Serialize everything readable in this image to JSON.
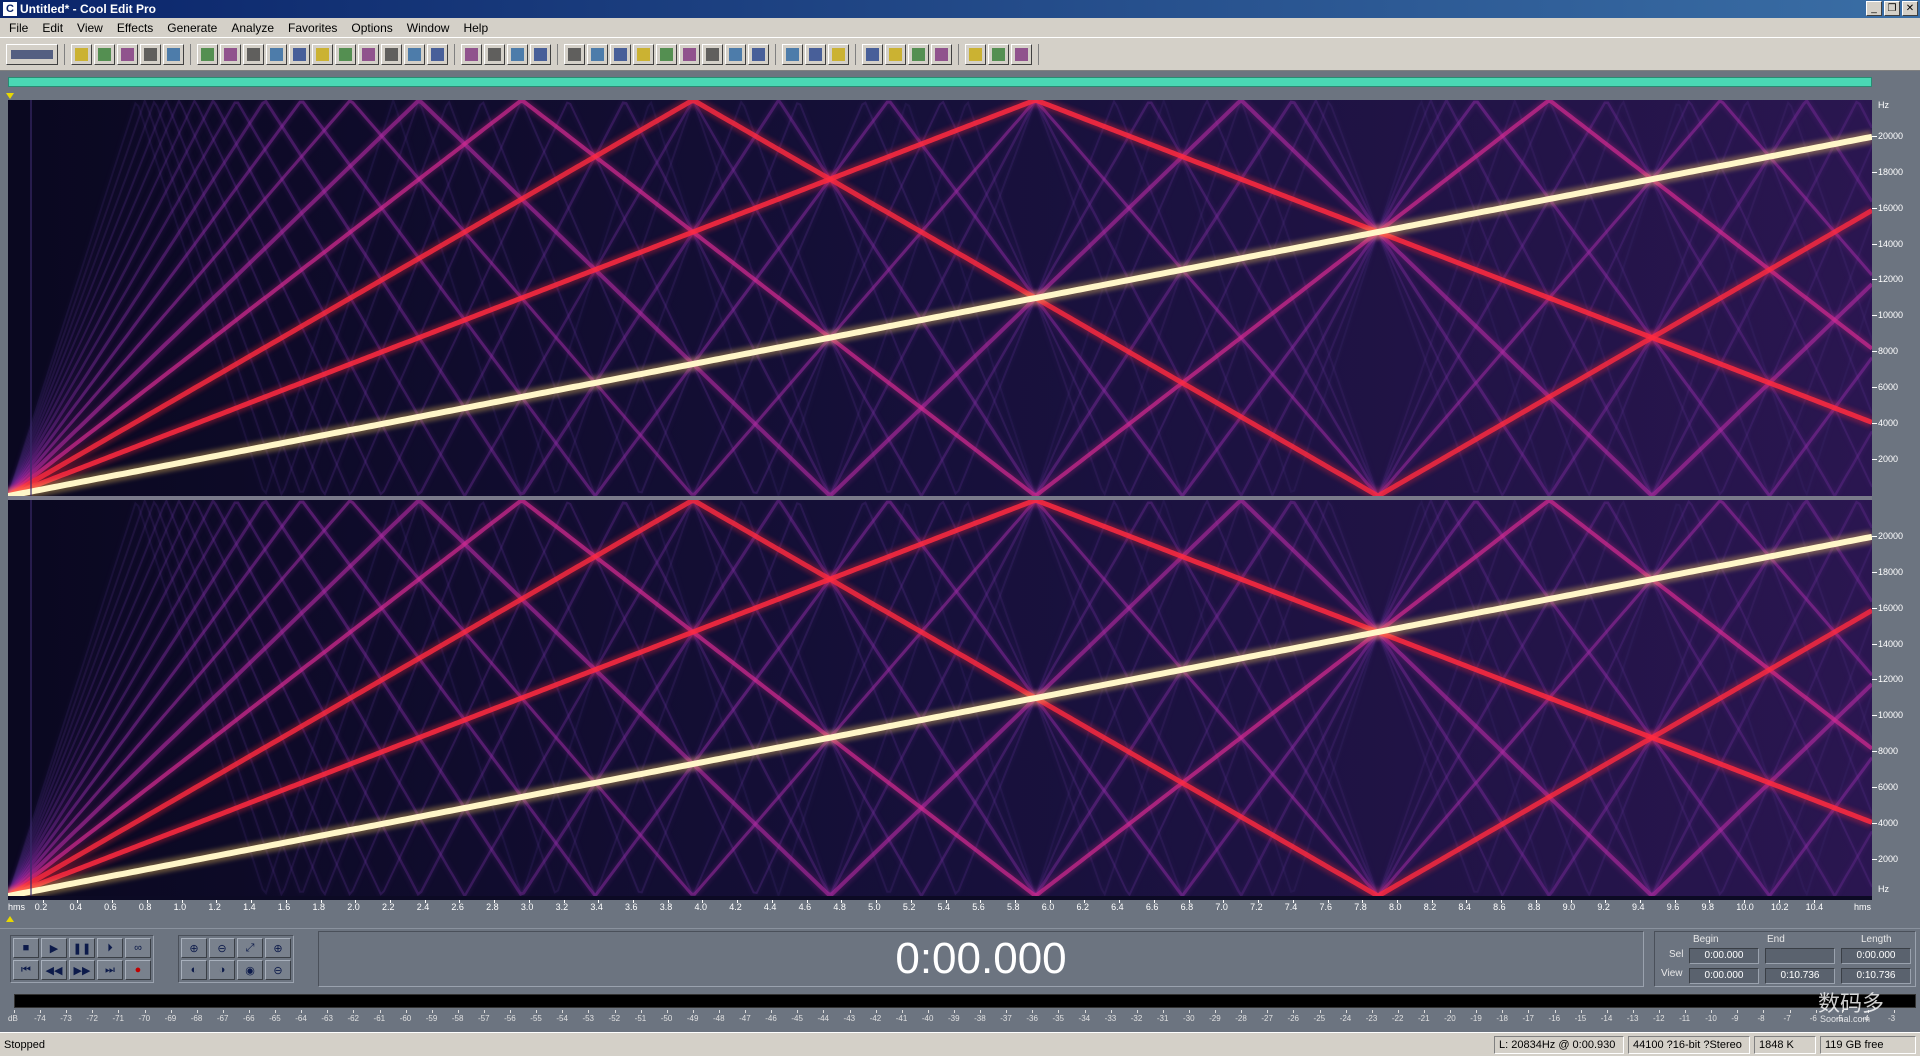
{
  "window": {
    "title": "Untitled* - Cool Edit Pro"
  },
  "menu": [
    "File",
    "Edit",
    "View",
    "Effects",
    "Generate",
    "Analyze",
    "Favorites",
    "Options",
    "Window",
    "Help"
  ],
  "toolbar_groups": [
    [
      "waveform-toggle"
    ],
    [
      "new-file",
      "open-file",
      "save",
      "save-as",
      "close"
    ],
    [
      "undo",
      "redo",
      "trim",
      "copy",
      "copy-new",
      "cut",
      "paste",
      "paste-new",
      "mix-paste",
      "repeat",
      "find"
    ],
    [
      "spectral-view",
      "edit-cue",
      "channel-mix",
      "mix-both"
    ],
    [
      "insert",
      "convert",
      "rate",
      "play",
      "zoom",
      "time-code",
      "bits",
      "meters",
      "settings"
    ],
    [
      "properties",
      "help-search",
      "help"
    ],
    [
      "brush-1",
      "brush-2",
      "brush-3",
      "brush-4"
    ],
    [
      "script-1",
      "script-2",
      "script-3"
    ]
  ],
  "frequency_axis": {
    "unit": "Hz",
    "ticks": [
      "20000",
      "18000",
      "16000",
      "14000",
      "12000",
      "10000",
      "8000",
      "6000",
      "4000",
      "2000"
    ]
  },
  "time_axis": {
    "start_label": "hms",
    "end_label": "hms",
    "ticks": [
      "0.2",
      "0.4",
      "0.6",
      "0.8",
      "1.0",
      "1.2",
      "1.4",
      "1.6",
      "1.8",
      "2.0",
      "2.2",
      "2.4",
      "2.6",
      "2.8",
      "3.0",
      "3.2",
      "3.4",
      "3.6",
      "3.8",
      "4.0",
      "4.2",
      "4.4",
      "4.6",
      "4.8",
      "5.0",
      "5.2",
      "5.4",
      "5.6",
      "5.8",
      "6.0",
      "6.2",
      "6.4",
      "6.6",
      "6.8",
      "7.0",
      "7.2",
      "7.4",
      "7.6",
      "7.8",
      "8.0",
      "8.2",
      "8.4",
      "8.6",
      "8.8",
      "9.0",
      "9.2",
      "9.4",
      "9.6",
      "9.8",
      "10.0",
      "10.2",
      "10.4"
    ],
    "max_seconds": 10.736
  },
  "transport": {
    "time": "0:00.000",
    "row1": [
      "stop",
      "play",
      "pause",
      "play-to-end",
      "loop"
    ],
    "row2": [
      "go-to-start",
      "rewind",
      "fast-forward",
      "go-to-end",
      "record"
    ],
    "zoom_row1": [
      "zoom-in-h",
      "zoom-out-h",
      "zoom-full",
      "zoom-in-v"
    ],
    "zoom_row2": [
      "zoom-left",
      "zoom-right",
      "zoom-sel",
      "zoom-out-v"
    ]
  },
  "selection": {
    "headers": [
      "Begin",
      "End",
      "Length"
    ],
    "sel_label": "Sel",
    "view_label": "View",
    "sel": [
      "0:00.000",
      "",
      "0:00.000"
    ],
    "view": [
      "0:00.000",
      "0:10.736",
      "0:10.736"
    ]
  },
  "level_meter": {
    "ticks": [
      "dB",
      "-74",
      "-73",
      "-72",
      "-71",
      "-70",
      "-69",
      "-68",
      "-67",
      "-66",
      "-65",
      "-64",
      "-63",
      "-62",
      "-61",
      "-60",
      "-59",
      "-58",
      "-57",
      "-56",
      "-55",
      "-54",
      "-53",
      "-52",
      "-51",
      "-50",
      "-49",
      "-48",
      "-47",
      "-46",
      "-45",
      "-44",
      "-43",
      "-42",
      "-41",
      "-40",
      "-39",
      "-38",
      "-37",
      "-36",
      "-35",
      "-34",
      "-33",
      "-32",
      "-31",
      "-30",
      "-29",
      "-28",
      "-27",
      "-26",
      "-25",
      "-24",
      "-23",
      "-22",
      "-21",
      "-20",
      "-19",
      "-18",
      "-17",
      "-16",
      "-15",
      "-14",
      "-13",
      "-12",
      "-11",
      "-10",
      "-9",
      "-8",
      "-7",
      "-6",
      "-5",
      "-4",
      "-3"
    ]
  },
  "status": {
    "state": "Stopped",
    "cursor": "L: 20834Hz @   0:00.930",
    "format": "44100 ?16-bit ?Stereo",
    "size": "1848 K",
    "free": "119 GB free"
  },
  "watermark": {
    "text": "数码多",
    "sub": "Soomal.com"
  }
}
